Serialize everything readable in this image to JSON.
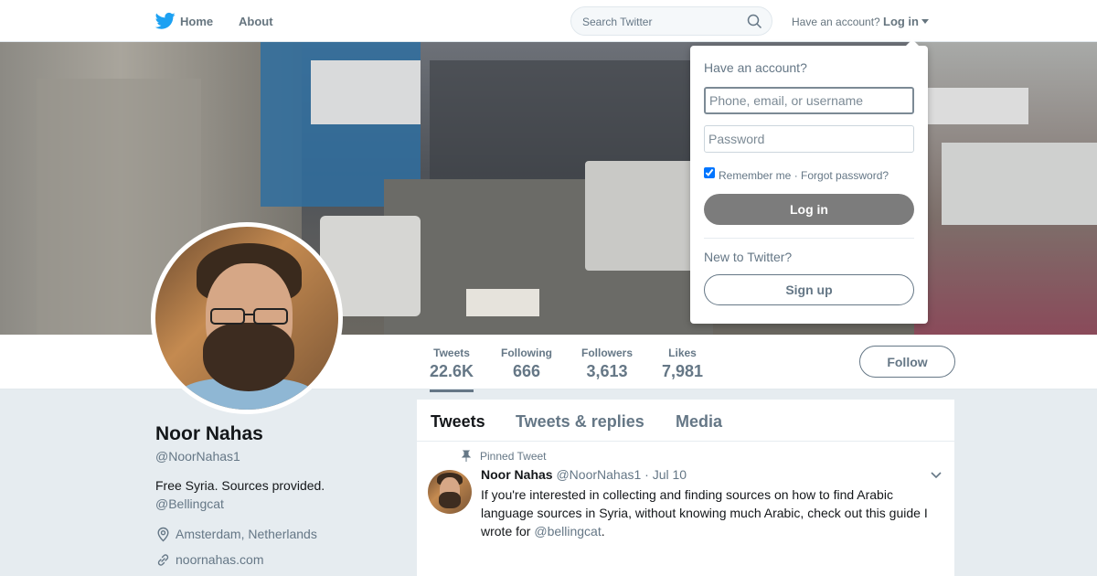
{
  "nav": {
    "home_label": "Home",
    "about_label": "About",
    "search_placeholder": "Search Twitter",
    "have_account": "Have an account?",
    "login_label": "Log in",
    "bird_icon": "twitter-bird-icon",
    "brand_color": "#1da1f2"
  },
  "profile": {
    "name": "Noor Nahas",
    "handle": "@NoorNahas1",
    "bio": "Free Syria. Sources provided.",
    "bio_link": "@Bellingcat",
    "location": "Amsterdam, Netherlands",
    "website": "noornahas.com"
  },
  "stats": [
    {
      "label": "Tweets",
      "value": "22.6K"
    },
    {
      "label": "Following",
      "value": "666"
    },
    {
      "label": "Followers",
      "value": "3,613"
    },
    {
      "label": "Likes",
      "value": "7,981"
    }
  ],
  "follow_label": "Follow",
  "timeline": {
    "tabs": [
      "Tweets",
      "Tweets & replies",
      "Media"
    ],
    "pinned_label": "Pinned Tweet",
    "tweet": {
      "name": "Noor Nahas",
      "handle": "@NoorNahas1",
      "dot": "·",
      "date": "Jul 10",
      "text": "If you're interested in collecting and finding sources on how to find Arabic language sources in Syria, without knowing much Arabic, check out this guide I wrote for ",
      "mention": "@bellingcat",
      "end": "."
    }
  },
  "login_dropdown": {
    "title": "Have an account?",
    "user_placeholder": "Phone, email, or username",
    "password_placeholder": "Password",
    "remember": "Remember me · Forgot password?",
    "login_button": "Log in",
    "new_to_twitter": "New to Twitter?",
    "signup_button": "Sign up"
  }
}
